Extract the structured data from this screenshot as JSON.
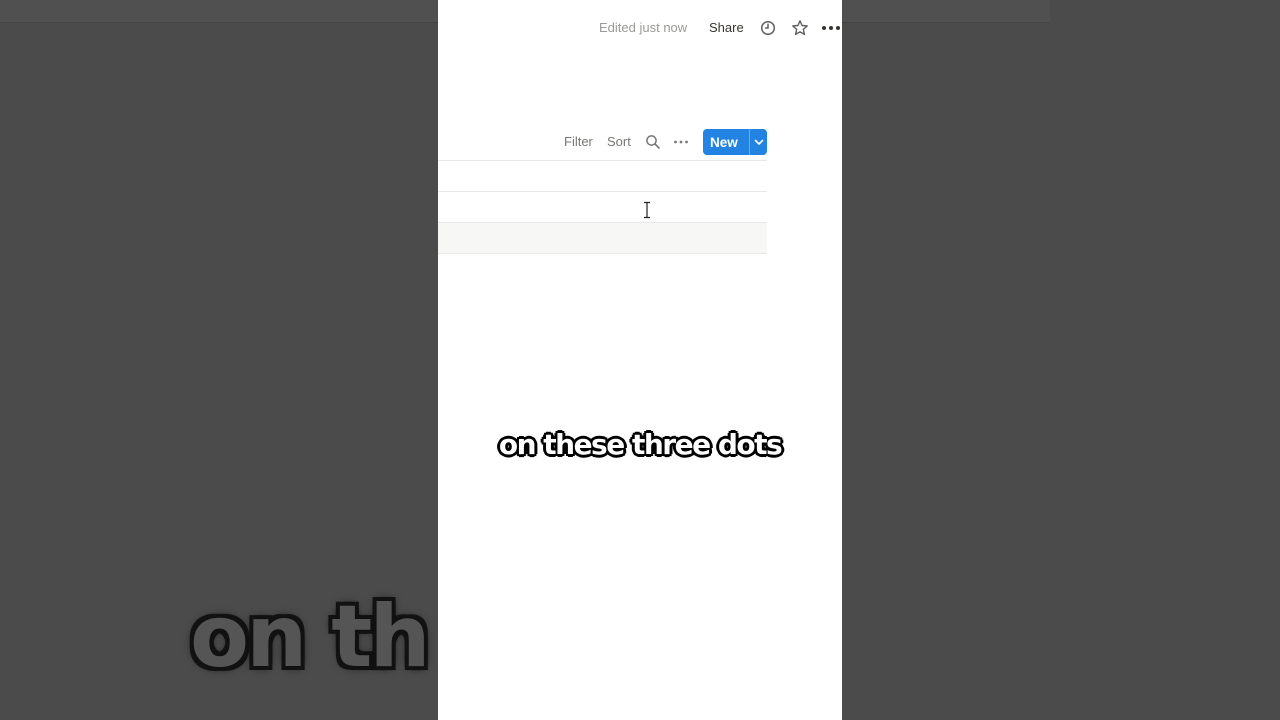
{
  "header": {
    "edited_status": "Edited just now",
    "share_label": "Share",
    "icons": [
      "clock-icon",
      "star-icon",
      "more-icon"
    ]
  },
  "toolbar": {
    "filter_label": "Filter",
    "sort_label": "Sort",
    "new_label": "New",
    "icons": [
      "search-icon",
      "more-icon",
      "chevron-down-icon"
    ]
  },
  "caption": {
    "text": "on these three dots",
    "background_text": "on th        e dots"
  },
  "colors": {
    "accent": "#2383e2",
    "muted_text": "#9b9a97",
    "primary_text": "#37352f",
    "backdrop": "#4a4a4a"
  }
}
